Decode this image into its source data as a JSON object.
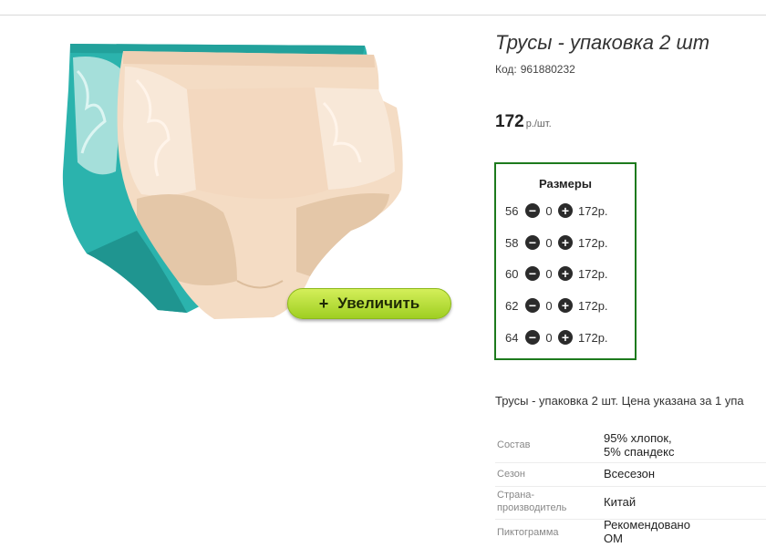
{
  "product": {
    "title": "Трусы - упаковка 2 шт",
    "code_label": "Код:",
    "code_value": "961880232",
    "price_value": "172",
    "price_unit": "р./шт.",
    "zoom_button": {
      "plus": "+",
      "label": "Увеличить"
    }
  },
  "sizes": {
    "title": "Размеры",
    "rows": [
      {
        "size": "56",
        "qty": "0",
        "price": "172р."
      },
      {
        "size": "58",
        "qty": "0",
        "price": "172р."
      },
      {
        "size": "60",
        "qty": "0",
        "price": "172р."
      },
      {
        "size": "62",
        "qty": "0",
        "price": "172р."
      },
      {
        "size": "64",
        "qty": "0",
        "price": "172р."
      }
    ],
    "minus_icon": "minus-circle-icon",
    "plus_icon": "plus-circle-icon"
  },
  "description": "Трусы - упаковка 2 шт. Цена указана за 1 упа",
  "properties": [
    {
      "key": "Состав",
      "value_lines": [
        "95% хлопок,",
        "5% спандекс"
      ]
    },
    {
      "key": "Сезон",
      "value_lines": [
        "Всесезон"
      ]
    },
    {
      "key_lines": [
        "Страна-",
        "производитель"
      ],
      "value_lines": [
        "Китай"
      ]
    },
    {
      "key": "Пиктограмма",
      "value_lines": [
        "Рекомендовано",
        "ОМ"
      ]
    }
  ],
  "colors": {
    "sizes_border": "#1d7a1d",
    "zoom_button": "#b5e03a"
  }
}
